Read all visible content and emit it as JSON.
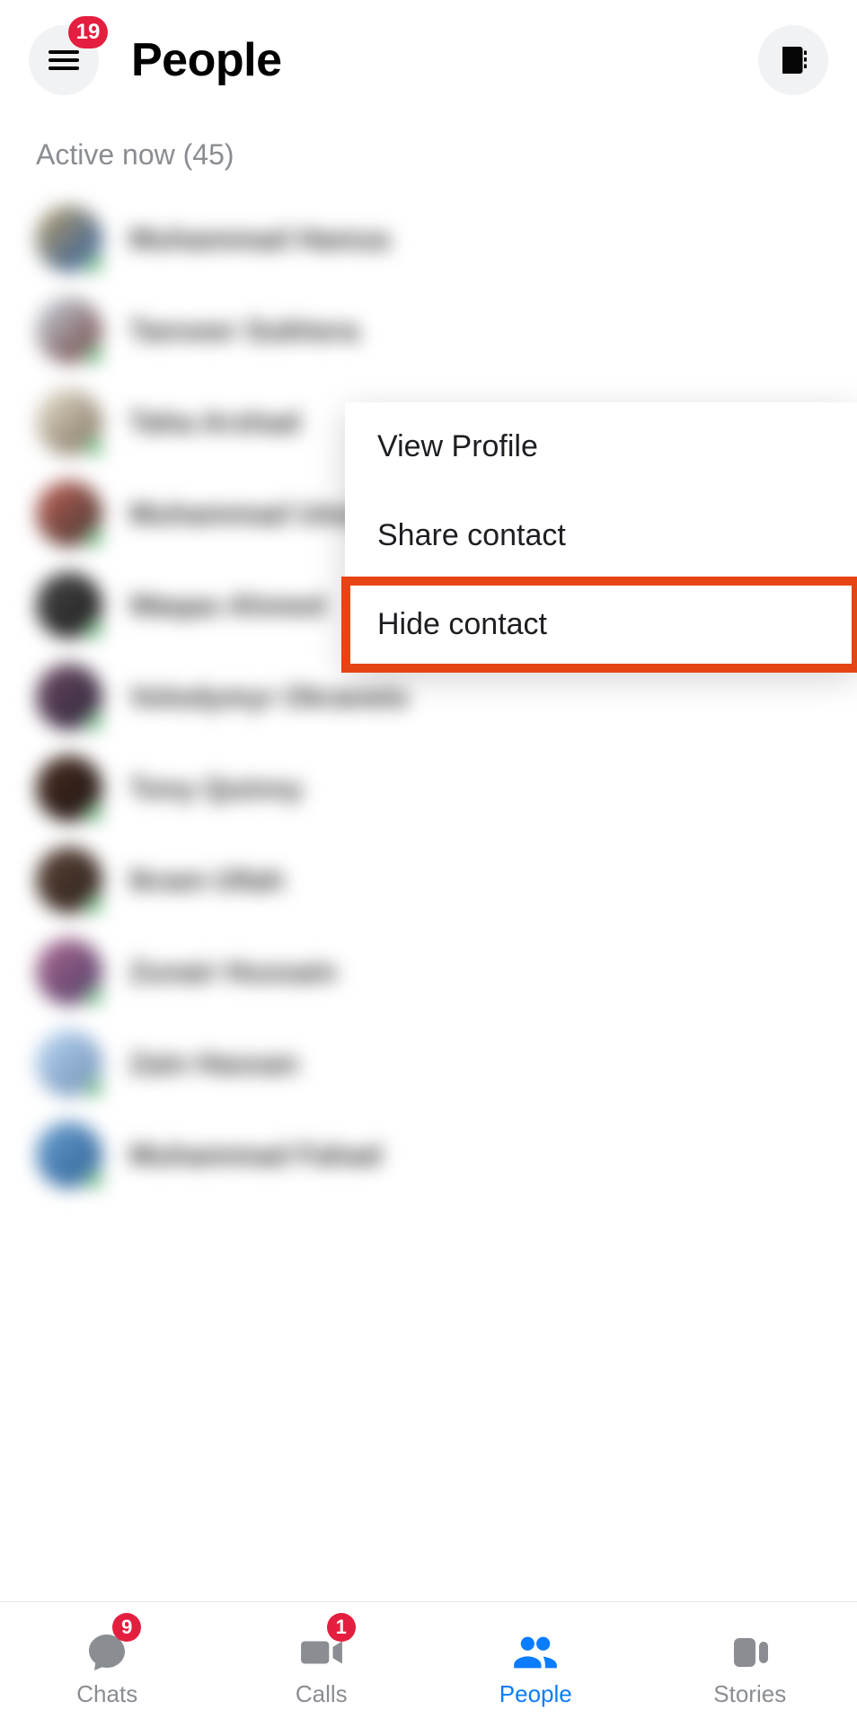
{
  "header": {
    "title": "People",
    "menu_badge": "19"
  },
  "section": {
    "label": "Active now (45)"
  },
  "contacts": [
    {
      "name": "Muhammad Hamza"
    },
    {
      "name": "Tanveer Sukhera"
    },
    {
      "name": "Taha Arshad"
    },
    {
      "name": "Muhammad Umar"
    },
    {
      "name": "Waqas Ahmed"
    },
    {
      "name": "Volodymyr Okranets"
    },
    {
      "name": "Tony Quinny"
    },
    {
      "name": "Ikram Ullah"
    },
    {
      "name": "Zunair Hussain"
    },
    {
      "name": "Zain Hassan"
    },
    {
      "name": "Muhammad Fahad"
    }
  ],
  "context_menu": {
    "items": [
      {
        "label": "View Profile"
      },
      {
        "label": "Share contact"
      },
      {
        "label": "Hide contact",
        "highlighted": true
      }
    ]
  },
  "nav": {
    "tabs": [
      {
        "label": "Chats",
        "badge": "9"
      },
      {
        "label": "Calls",
        "badge": "1"
      },
      {
        "label": "People",
        "active": true
      },
      {
        "label": "Stories"
      }
    ]
  }
}
